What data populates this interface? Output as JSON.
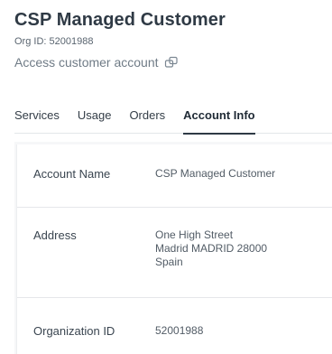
{
  "header": {
    "title": "CSP Managed Customer",
    "org_id": "Org ID: 52001988",
    "access_link": "Access customer account",
    "access_icon": "external-link-icon"
  },
  "tabs": [
    {
      "label": "Services",
      "active": false
    },
    {
      "label": "Usage",
      "active": false
    },
    {
      "label": "Orders",
      "active": false
    },
    {
      "label": "Account Info",
      "active": true
    }
  ],
  "account_info": {
    "account_name": {
      "label": "Account Name",
      "value": "CSP Managed Customer"
    },
    "address": {
      "label": "Address",
      "lines": [
        "One High Street",
        "Madrid MADRID 28000",
        "Spain"
      ]
    },
    "organization_id": {
      "label": "Organization ID",
      "value": "52001988"
    }
  }
}
